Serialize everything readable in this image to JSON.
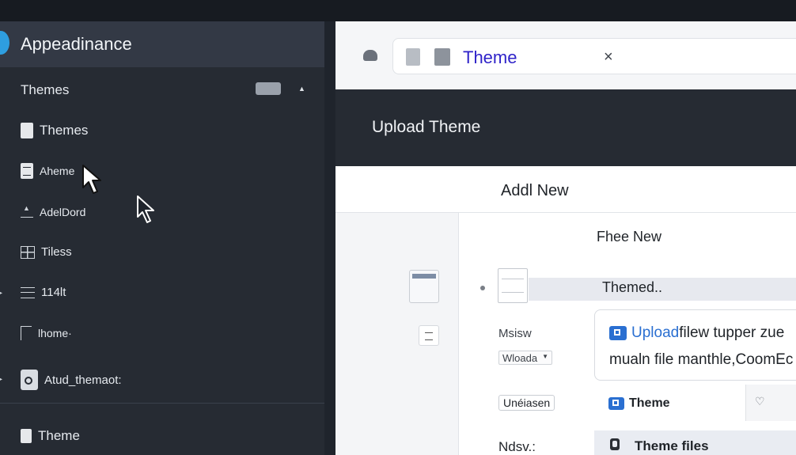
{
  "sidebar": {
    "title": "Appeadinance",
    "items": [
      {
        "label": "Themes"
      },
      {
        "label": "Themes"
      },
      {
        "label": "Aheme"
      },
      {
        "label": "AdelDord"
      },
      {
        "label": "Tiless"
      },
      {
        "label": "114lt"
      },
      {
        "label": "lhome·"
      },
      {
        "label": "Atud_themaot:"
      },
      {
        "label": "Theme"
      }
    ]
  },
  "tab": {
    "label": "Theme",
    "close": "×"
  },
  "upload_header": "Upload Theme",
  "content": {
    "add_new": "Addl New",
    "free_new": "Fhee New",
    "themed": "Themed..",
    "field_label_1": "Msisw",
    "dropdown_value": "Wloada",
    "upload_link": "Upload",
    "upload_line1_rest": " filew tupper zue",
    "upload_line2": "mualn file manthle,CoomEc",
    "field_label_2": "Unéiasen",
    "theme_label": "Theme",
    "field_label_3": "Ndsv.:",
    "theme_files": "Theme files"
  },
  "icons": {
    "close": "close-icon",
    "caret": "caret-up-icon",
    "heart": "heart-icon"
  },
  "colors": {
    "sidebar_bg": "#262b33",
    "accent_blue": "#2a6fd1",
    "tab_label": "#2f23c9"
  }
}
